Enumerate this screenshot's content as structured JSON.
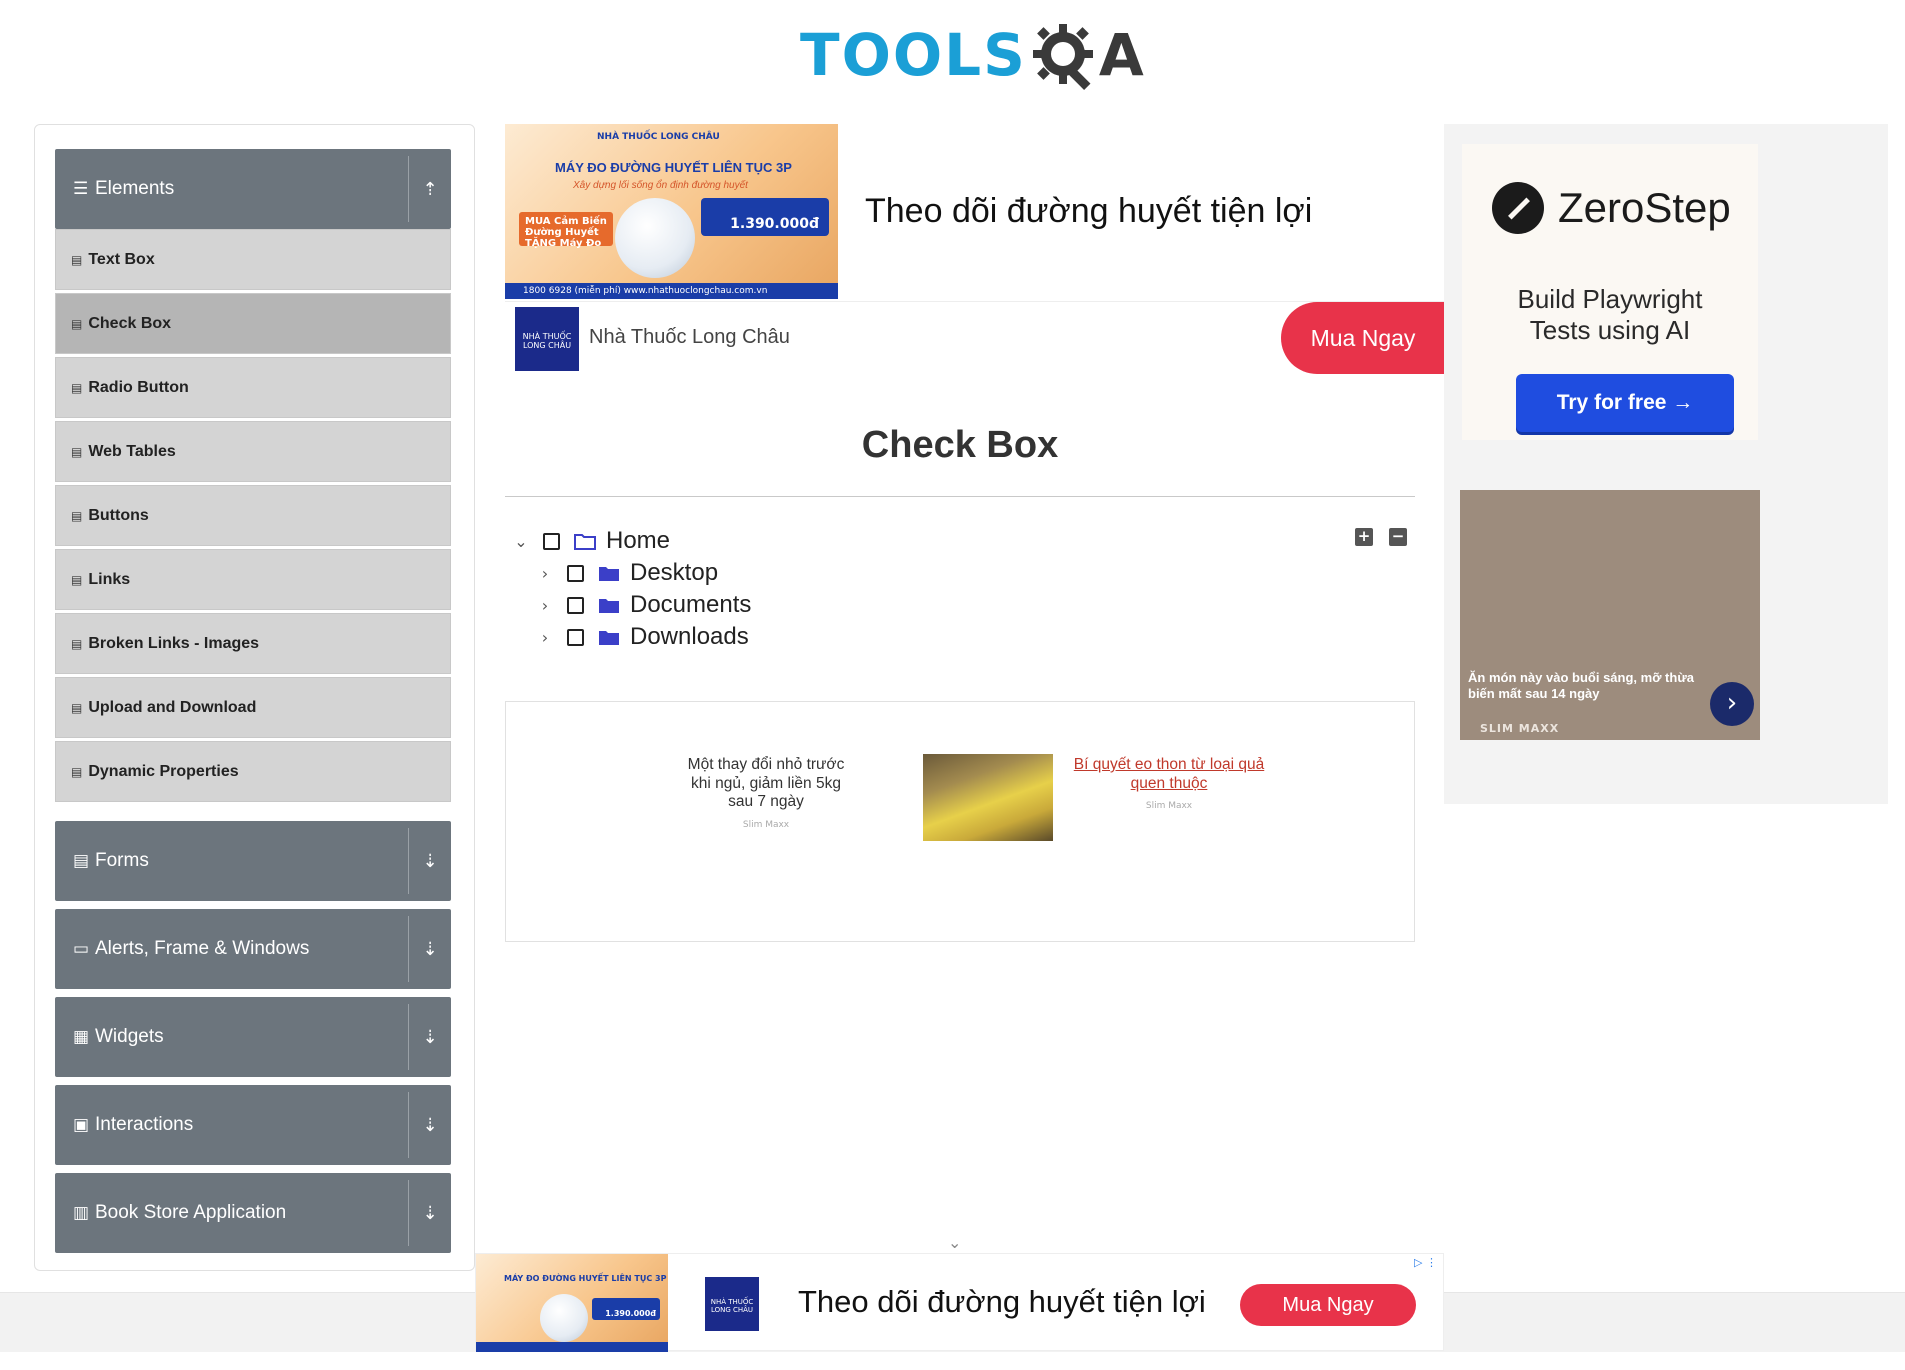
{
  "header": {
    "logo_text": "TOOLS",
    "logo_tail": "A"
  },
  "sidebar": {
    "groups": [
      {
        "label": "Elements",
        "icon": "hamburger-icon",
        "arrow": "upload-icon",
        "expanded": true
      },
      {
        "label": "Forms",
        "icon": "file-icon",
        "arrow": "download-icon",
        "expanded": false
      },
      {
        "label": "Alerts, Frame & Windows",
        "icon": "window-icon",
        "arrow": "download-icon",
        "expanded": false
      },
      {
        "label": "Widgets",
        "icon": "widgets-icon",
        "arrow": "download-icon",
        "expanded": false
      },
      {
        "label": "Interactions",
        "icon": "interactions-icon",
        "arrow": "download-icon",
        "expanded": false
      },
      {
        "label": "Book Store Application",
        "icon": "books-icon",
        "arrow": "download-icon",
        "expanded": false
      }
    ],
    "items": [
      {
        "label": "Text Box",
        "active": false
      },
      {
        "label": "Check Box",
        "active": true
      },
      {
        "label": "Radio Button",
        "active": false
      },
      {
        "label": "Web Tables",
        "active": false
      },
      {
        "label": "Buttons",
        "active": false
      },
      {
        "label": "Links",
        "active": false
      },
      {
        "label": "Broken Links - Images",
        "active": false
      },
      {
        "label": "Upload and Download",
        "active": false
      },
      {
        "label": "Dynamic Properties",
        "active": false
      }
    ]
  },
  "top_ad": {
    "image_headline": "MÁY ĐO ĐƯỜNG HUYẾT LIÊN TỤC 3P",
    "image_tagline": "Xây dựng lối sống ổn định đường huyết",
    "image_brand": "NHÀ THUỐC LONG CHÂU",
    "image_promo": "MUA Cảm Biến Đường Huyết TẶNG Máy Đo",
    "image_price": "1.390.000đ",
    "image_footer": "1800 6928 (miễn phí)   www.nhathuoclongchau.com.vn",
    "title": "Theo dõi đường huyết tiện lợi",
    "pharmacy_logo_text": "NHÀ THUỐC LONG CHÂU",
    "pharmacy_name": "Nhà Thuốc Long Châu",
    "cta": "Mua Ngay"
  },
  "main": {
    "title": "Check Box",
    "tree": [
      {
        "label": "Home",
        "level": 0,
        "toggle": "expanded",
        "checked": false
      },
      {
        "label": "Desktop",
        "level": 1,
        "toggle": "collapsed",
        "checked": false
      },
      {
        "label": "Documents",
        "level": 1,
        "toggle": "collapsed",
        "checked": false
      },
      {
        "label": "Downloads",
        "level": 1,
        "toggle": "collapsed",
        "checked": false
      }
    ],
    "expand_all": "+",
    "collapse_all": "−"
  },
  "content_ad": {
    "left_text": "Một thay đổi nhỏ trước khi ngủ, giảm liền 5kg sau 7 ngày",
    "left_source": "Slim Maxx",
    "right_link": "Bí quyết eo thon từ loại quả quen thuộc",
    "right_source": "Slim Maxx"
  },
  "right_ad": {
    "brand": "ZeroStep",
    "subtitle_line1": "Build Playwright",
    "subtitle_line2": "Tests using AI",
    "cta": "Try for free →",
    "promo_text": "Ăn món này vào buổi sáng, mỡ thừa biến mất sau 14 ngày",
    "promo_brand": "SLIM MAXX",
    "promo_next": "›"
  },
  "bottom_ad": {
    "title": "Theo dõi đường huyết tiện lợi",
    "cta": "Mua Ngay",
    "logo_text": "NHÀ THUỐC LONG CHÂU",
    "image_headline": "MÁY ĐO ĐƯỜNG HUYẾT LIÊN TỤC 3P",
    "image_price": "1.390.000đ",
    "ad_choices": "▷ ⋮"
  },
  "colors": {
    "group_header": "#6c757d",
    "menu_item": "#d4d4d4",
    "menu_item_active": "#b5b5b5",
    "logo_blue": "#1b9fd6",
    "cta_red": "#e8334a",
    "zerostep_blue": "#1f4de0",
    "folder_blue": "#3b3fc8"
  }
}
